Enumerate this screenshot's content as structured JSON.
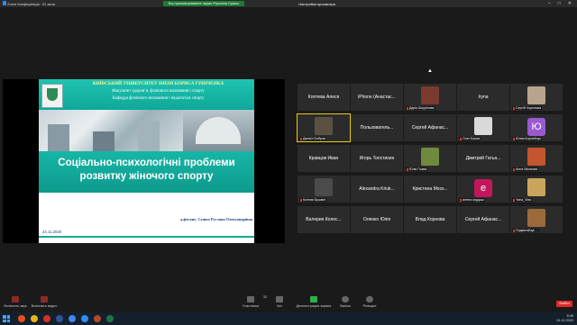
{
  "titlebar": {
    "app_title": "Zoom Конференція · ID зала",
    "share_banner": "Вы просматриваете экран Руслана Сушко",
    "options": "Настройки просмотра"
  },
  "slide": {
    "university": "КИЇВСЬКИЙ УНІВЕРСИТЕТ ІМЕНІ БОРИСА ГРІНЧЕНКА",
    "faculty": "Факультет здоров’я, фізичного виховання і спорту",
    "department": "Кафедра фізичного виховання і педагогіки спорту",
    "title_line1": "Соціально-психологічні проблеми",
    "title_line2": "розвитку жіночого спорту",
    "author": "д.фіз.вих. Сушко Руслана Олександрівна",
    "date": "24.11.2020"
  },
  "participants": [
    {
      "name": "Коптева Алеся",
      "style": "name"
    },
    {
      "name": "iPhone (Анастас...",
      "style": "name"
    },
    {
      "name": "Дарія Шкурінова",
      "style": "photo",
      "color": "#7a3b2e"
    },
    {
      "name": "Iryna",
      "style": "name"
    },
    {
      "name": "Сергій Чорномаз",
      "style": "photo",
      "color": "#b8a48c"
    },
    {
      "name": "Даниїл Бобров",
      "style": "photo",
      "color": "#5a5142",
      "active": true
    },
    {
      "name": "Пользователь...",
      "style": "name"
    },
    {
      "name": "Сергей Афанас...",
      "style": "name"
    },
    {
      "name": "Олег Бахов",
      "style": "photo",
      "color": "#d9d9d9"
    },
    {
      "name": "Юлия Корнейчук",
      "style": "letter",
      "letter": "Ю",
      "color": "#9b59d0"
    },
    {
      "name": "Кравцов Иван",
      "style": "name"
    },
    {
      "name": "Игорь Толстихин",
      "style": "name"
    },
    {
      "name": "Юлія Гожва",
      "style": "photo",
      "color": "#6f8a3d"
    },
    {
      "name": "Дмитрий Гатьа...",
      "style": "name"
    },
    {
      "name": "Анна Малкова",
      "style": "photo",
      "color": "#c4552e"
    },
    {
      "name": "Ксения Бушмін",
      "style": "photo",
      "color": "#4b4b4b"
    },
    {
      "name": "Alexandra Kriuk...",
      "style": "name"
    },
    {
      "name": "Кристина Моск...",
      "style": "name"
    },
    {
      "name": "алена кардаш",
      "style": "letter",
      "letter": "е",
      "color": "#c2185b"
    },
    {
      "name": "Yana_Vlas",
      "style": "photo",
      "color": "#c9a55c"
    },
    {
      "name": "Валерия Колес...",
      "style": "name"
    },
    {
      "name": "Оленко Юлія",
      "style": "name"
    },
    {
      "name": "Влад Корнова",
      "style": "name"
    },
    {
      "name": "Сергей Афанас...",
      "style": "name"
    },
    {
      "name": "Подвигайчук ...",
      "style": "photo",
      "color": "#9a6a3a"
    }
  ],
  "controls": {
    "unmute": "Включить звук",
    "start_video": "Включить видео",
    "participants": "Участники",
    "participants_count": "32",
    "chat": "Чат",
    "share_screen": "Демонстрация экрана",
    "record": "Запись",
    "reactions": "Реакции",
    "end": "Выйти"
  },
  "taskbar": {
    "time": "8:45",
    "date": "24.11.2020"
  }
}
